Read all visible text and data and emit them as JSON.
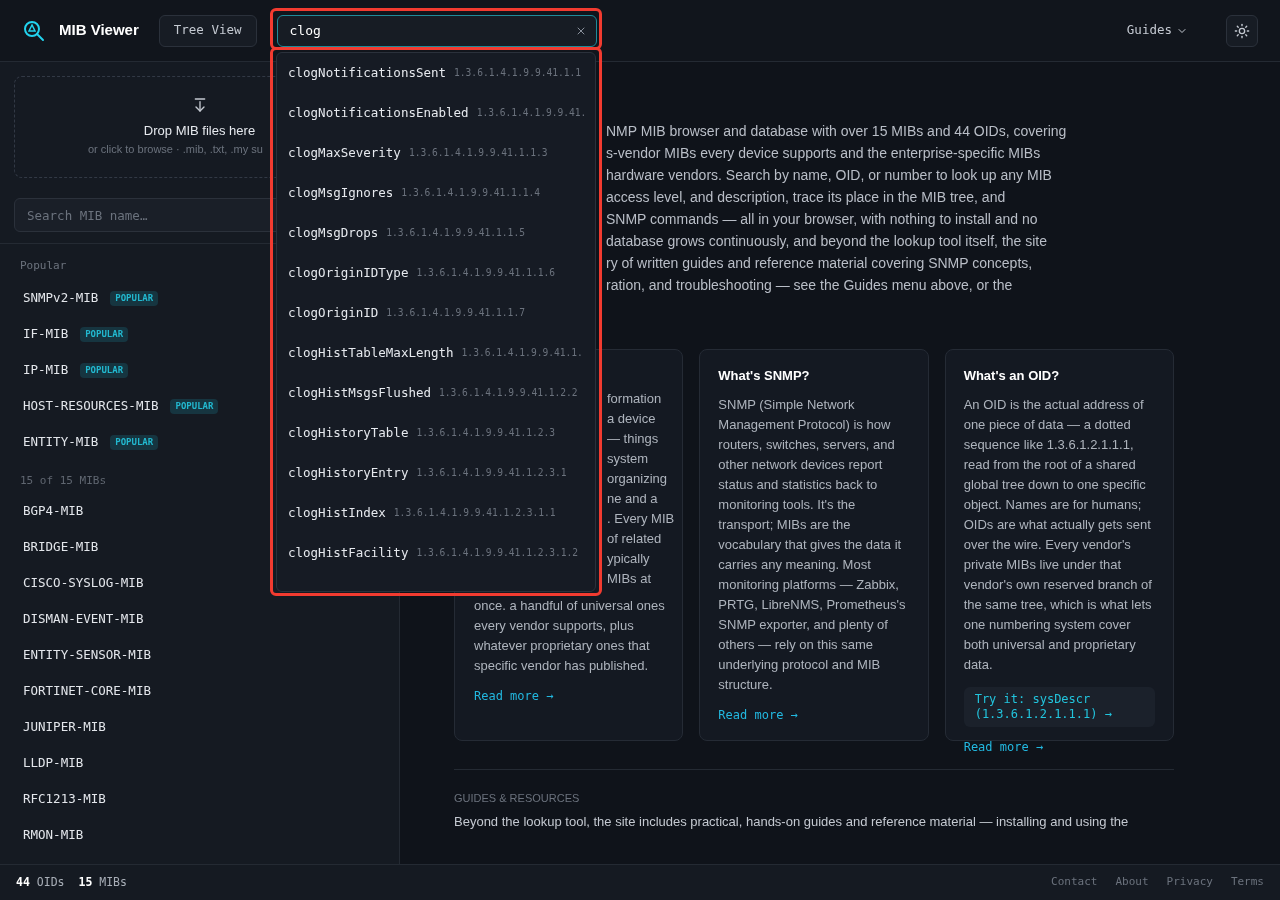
{
  "header": {
    "title": "MIB Viewer",
    "tree_view_button": "Tree View",
    "search": {
      "value": "clog"
    },
    "guides_menu": "Guides"
  },
  "suggestions": [
    {
      "name": "clogNotificationsSent",
      "oid": "1.3.6.1.4.1.9.9.41.1.1"
    },
    {
      "name": "clogNotificationsEnabled",
      "oid": "1.3.6.1.4.1.9.9.41."
    },
    {
      "name": "clogMaxSeverity",
      "oid": "1.3.6.1.4.1.9.9.41.1.1.3"
    },
    {
      "name": "clogMsgIgnores",
      "oid": "1.3.6.1.4.1.9.9.41.1.1.4"
    },
    {
      "name": "clogMsgDrops",
      "oid": "1.3.6.1.4.1.9.9.41.1.1.5"
    },
    {
      "name": "clogOriginIDType",
      "oid": "1.3.6.1.4.1.9.9.41.1.1.6"
    },
    {
      "name": "clogOriginID",
      "oid": "1.3.6.1.4.1.9.9.41.1.1.7"
    },
    {
      "name": "clogHistTableMaxLength",
      "oid": "1.3.6.1.4.1.9.9.41.1."
    },
    {
      "name": "clogHistMsgsFlushed",
      "oid": "1.3.6.1.4.1.9.9.41.1.2.2"
    },
    {
      "name": "clogHistoryTable",
      "oid": "1.3.6.1.4.1.9.9.41.1.2.3"
    },
    {
      "name": "clogHistoryEntry",
      "oid": "1.3.6.1.4.1.9.9.41.1.2.3.1"
    },
    {
      "name": "clogHistIndex",
      "oid": "1.3.6.1.4.1.9.9.41.1.2.3.1.1"
    },
    {
      "name": "clogHistFacility",
      "oid": "1.3.6.1.4.1.9.9.41.1.2.3.1.2"
    }
  ],
  "sidebar": {
    "drop_zone": {
      "title": "Drop MIB files here",
      "hint": "or click to browse · .mib, .txt, .my su"
    },
    "search": {
      "placeholder": "Search MIB name…"
    },
    "popular_label": "Popular",
    "popular": [
      {
        "name": "SNMPv2-MIB",
        "badge": "POPULAR"
      },
      {
        "name": "IF-MIB",
        "badge": "POPULAR"
      },
      {
        "name": "IP-MIB",
        "badge": "POPULAR"
      },
      {
        "name": "HOST-RESOURCES-MIB",
        "badge": "POPULAR"
      },
      {
        "name": "ENTITY-MIB",
        "badge": "POPULAR"
      }
    ],
    "count_label": "15 of 15 MIBs",
    "mibs": [
      "BGP4-MIB",
      "BRIDGE-MIB",
      "CISCO-SYSLOG-MIB",
      "DISMAN-EVENT-MIB",
      "ENTITY-SENSOR-MIB",
      "FORTINET-CORE-MIB",
      "JUNIPER-MIB",
      "LLDP-MIB",
      "RFC1213-MIB",
      "RMON-MIB"
    ]
  },
  "main": {
    "intro_lines": [
      "NMP MIB browser and database with over 15 MIBs and 44 OIDs, covering",
      "s-vendor MIBs every device supports and the enterprise-specific MIBs",
      "hardware vendors. Search by name, OID, or number to look up any MIB",
      "access level, and description, trace its place in the MIB tree, and",
      "SNMP commands — all in your browser, with nothing to install and no",
      "database grows continuously, and beyond the lookup tool itself, the site",
      "ry of written guides and reference material covering SNMP concepts,",
      "ration, and troubleshooting — see the Guides menu above, or the"
    ],
    "first_card": {
      "covered_lines": [
        "formation",
        "a device",
        "— things",
        "system",
        "organizing",
        "ne and a",
        ". Every MIB",
        "of related",
        "ypically",
        "MIBs at"
      ],
      "lines": [
        "once. a handful of universal ones",
        "every vendor supports, plus",
        "whatever proprietary ones that",
        "specific vendor has published."
      ],
      "link": "Read more →"
    },
    "cards": [
      {
        "title": "What's SNMP?",
        "body": "SNMP (Simple Network Management Protocol) is how routers, switches, servers, and other network devices report status and statistics back to monitoring tools. It's the transport; MIBs are the vocabulary that gives the data it carries any meaning. Most monitoring platforms — Zabbix, PRTG, LibreNMS, Prometheus's SNMP exporter, and plenty of others — rely on this same underlying protocol and MIB structure.",
        "link": "Read more →"
      },
      {
        "title": "What's an OID?",
        "body": "An OID is the actual address of one piece of data — a dotted sequence like 1.3.6.1.2.1.1.1, read from the root of a shared global tree down to one specific object. Names are for humans; OIDs are what actually gets sent over the wire. Every vendor's private MIBs live under that vendor's own reserved branch of the same tree, which is what lets one numbering system cover both universal and proprietary data.",
        "try_it": "Try it: sysDescr (1.3.6.1.2.1.1.1) →",
        "link": "Read more →"
      }
    ],
    "guides": {
      "title": "GUIDES & RESOURCES",
      "text": "Beyond the lookup tool, the site includes practical, hands-on guides and reference material — installing and using the"
    }
  },
  "footer": {
    "counts": [
      "**44** OIDs",
      "**15** MIBs"
    ],
    "links": [
      "Contact",
      "About",
      "Privacy",
      "Terms"
    ]
  }
}
